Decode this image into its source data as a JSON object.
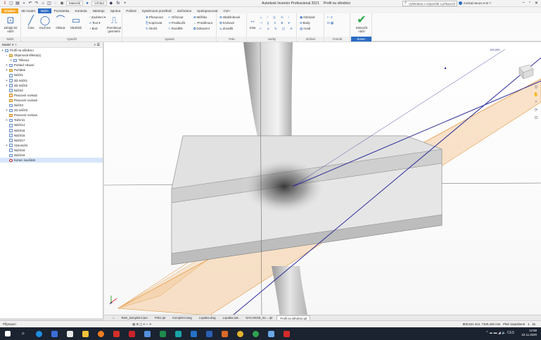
{
  "titlebar": {
    "material": "Materiál",
    "appearance": "Vzhled",
    "app_name": "Autodesk Inventor Professional 2021",
    "document": "Profil na střednici",
    "search_placeholder": "Vyhledávat v nápovědě a příkazech",
    "user": "michal.neuzo",
    "help": "?"
  },
  "tabs": [
    "Soubor",
    "3D model",
    "Náčrt",
    "Poznámka",
    "Kontrola",
    "Nástroje",
    "Správa",
    "Pohled",
    "Systémové prostředí",
    "Začínáme",
    "Spolupracovat",
    "CIZ+"
  ],
  "tab_sketch": "Soubor",
  "tab_active": "Náčrt",
  "ribbon": {
    "sketch_panel": {
      "label": "Náčrt",
      "start": "Zahájit 2D náčrt"
    },
    "create_panel": {
      "label": "Vytvořit",
      "line": "Čára",
      "circle": "Kružnice",
      "arc": "Oblouk",
      "rect": "Obdélník",
      "fillet": "Zaoblení",
      "text": "Text",
      "point": "Bod",
      "project": "Promítnout geometrii"
    },
    "modify_panel": {
      "label": "Upravit",
      "move": "Přesunout",
      "copy": "Kopírovat",
      "rotate": "Otočit",
      "trim": "Oříznout",
      "extend": "Prodloužit",
      "split": "Rozdělit",
      "scale": "Měřítko",
      "stretch": "Protáhnout",
      "offset": "Odsazení"
    },
    "pattern_panel": {
      "label": "Pole",
      "rect": "Obdélníkové",
      "circ": "Kruhové",
      "mirror": "Zrcadlit"
    },
    "constrain_panel": {
      "label": "Vazby",
      "dim": "Kóta"
    },
    "insert_panel": {
      "label": "Vložení",
      "image": "Obrázek",
      "points": "Body",
      "acad": "Acad"
    },
    "format_panel": {
      "label": "Formát"
    },
    "finish_panel": {
      "label": "Konec",
      "finish": "Dokončit náčrt"
    }
  },
  "browser": {
    "title": "Model",
    "items": [
      {
        "label": "Profil na střednici",
        "level": 0,
        "icon": "part"
      },
      {
        "label": "Objemová tělesa(1)",
        "level": 1,
        "icon": "folder"
      },
      {
        "label": "Těleso1",
        "level": 2,
        "icon": "part"
      },
      {
        "label": "Pohled: Hlavní",
        "level": 1,
        "icon": "part"
      },
      {
        "label": "Počátek",
        "level": 1,
        "icon": "folder"
      },
      {
        "label": "Náčrt1",
        "level": 1,
        "icon": "part"
      },
      {
        "label": "3D náčrt1",
        "level": 1,
        "icon": "part"
      },
      {
        "label": "3D náčrt2",
        "level": 1,
        "icon": "part"
      },
      {
        "label": "Náčrt2",
        "level": 1,
        "icon": "part"
      },
      {
        "label": "Pracovní rovina2",
        "level": 1,
        "icon": "orange"
      },
      {
        "label": "Pracovní rovina3",
        "level": 1,
        "icon": "orange"
      },
      {
        "label": "Náčrt3",
        "level": 1,
        "icon": "part"
      },
      {
        "label": "3D náčrt3",
        "level": 1,
        "icon": "part"
      },
      {
        "label": "Pracovní rovina4",
        "level": 1,
        "icon": "orange"
      },
      {
        "label": "Tažení1",
        "level": 1,
        "icon": "part"
      },
      {
        "label": "Náčrt14",
        "level": 1,
        "icon": "part"
      },
      {
        "label": "Náčrt15",
        "level": 1,
        "icon": "part"
      },
      {
        "label": "Náčrt16",
        "level": 1,
        "icon": "part"
      },
      {
        "label": "Náčrt17",
        "level": 1,
        "icon": "part"
      },
      {
        "label": "Vysunutí1",
        "level": 1,
        "icon": "part"
      },
      {
        "label": "Náčrt18",
        "level": 1,
        "icon": "part"
      },
      {
        "label": "Náčrt19",
        "level": 1,
        "icon": "part"
      },
      {
        "label": "Konec součásti",
        "level": 1,
        "icon": "red"
      }
    ]
  },
  "doctabs": [
    "Rám_kompletní.iam",
    "P001.ipt",
    "Kompletní.dwg",
    "Lopatka.dwg",
    "Lopatka.iam",
    "NACA0018_Inc....ipt",
    "Profil na střednici.ipt"
  ],
  "status": {
    "left": "Připraven",
    "coords": "800,521 mm, 7100,403 mm",
    "right": "Plně zavazbené",
    "page": "1",
    "count": "16"
  },
  "taskbar": {
    "time": "12:58",
    "date": "22.11.2020",
    "lang": "CES"
  },
  "viewport": {
    "dim_label": "100,000"
  }
}
